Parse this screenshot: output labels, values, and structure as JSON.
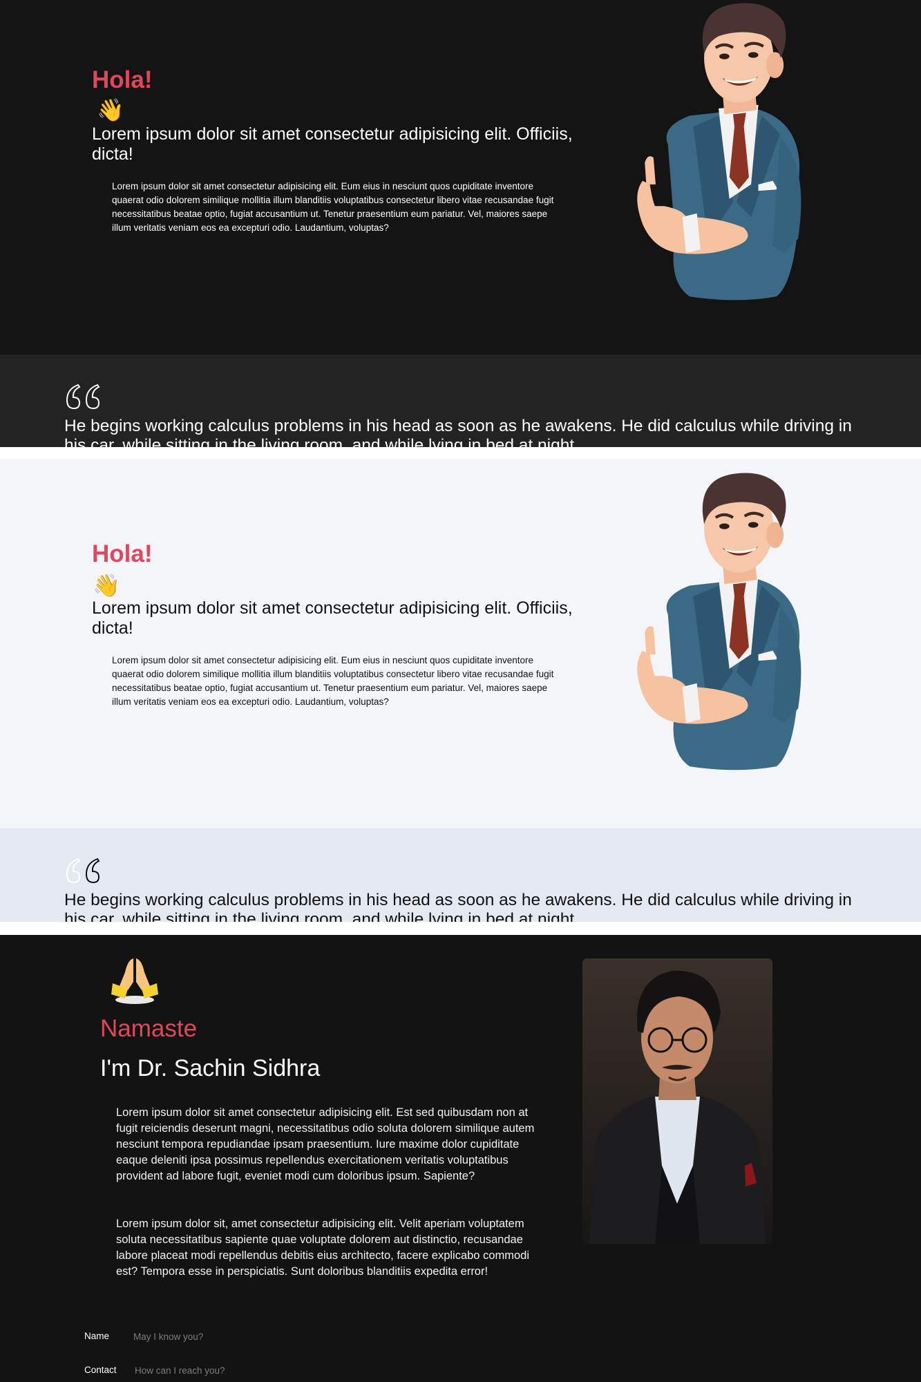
{
  "hero_dark": {
    "greeting": "Hola!",
    "wave": "👋",
    "headline": "Lorem ipsum dolor sit amet consectetur adipisicing elit. Officiis, dicta!",
    "paragraph": "Lorem ipsum dolor sit amet consectetur adipisicing elit. Eum eius in nesciunt quos cupiditate inventore quaerat odio dolorem similique mollitia illum blanditiis voluptatibus consectetur libero vitae recusandae fugit necessitatibus beatae optio, fugiat accusantium ut. Tenetur praesentium eum pariatur. Vel, maiores saepe illum veritatis veniam eos ea excepturi odio. Laudantium, voluptas?"
  },
  "quote_dark": {
    "text": "He begins working calculus problems in his head as soon as he awakens. He did calculus while driving in his car, while sitting in the living room, and while lying in bed at night."
  },
  "hero_light": {
    "greeting": "Hola!",
    "wave": "👋",
    "headline": "Lorem ipsum dolor sit amet consectetur adipisicing elit. Officiis, dicta!",
    "paragraph": "Lorem ipsum dolor sit amet consectetur adipisicing elit. Eum eius in nesciunt quos cupiditate inventore quaerat odio dolorem similique mollitia illum blanditiis voluptatibus consectetur libero vitae recusandae fugit necessitatibus beatae optio, fugiat accusantium ut. Tenetur praesentium eum pariatur. Vel, maiores saepe illum veritatis veniam eos ea excepturi odio. Laudantium, voluptas?"
  },
  "quote_light": {
    "text": "He begins working calculus problems in his head as soon as he awakens. He did calculus while driving in his car, while sitting in the living room, and while lying in bed at night."
  },
  "about": {
    "greeting": "Namaste",
    "intro": "I'm Dr. Sachin Sidhra",
    "paragraph1": "Lorem ipsum dolor sit amet consectetur adipisicing elit. Est sed quibusdam non at fugit reiciendis deserunt magni, necessitatibus odio soluta dolorem similique autem nesciunt tempora repudiandae ipsam praesentium. Iure maxime dolor cupiditate eaque deleniti ipsa possimus repellendus exercitationem veritatis voluptatibus provident ad labore fugit, eveniet modi cum doloribus ipsum. Sapiente?",
    "paragraph2": "Lorem ipsum dolor sit, amet consectetur adipisicing elit. Velit aperiam voluptatem soluta necessitatibus sapiente quae voluptate dolorem aut distinctio, recusandae labore placeat modi repellendus debitis eius architecto, facere explicabo commodi est? Tempora esse in perspiciatis. Sunt doloribus blanditiis expedita error!"
  },
  "form": {
    "name_label": "Name",
    "name_placeholder": "May I know you?",
    "contact_label": "Contact",
    "contact_placeholder": "How can I reach you?"
  },
  "colors": {
    "accent": "#e0475d",
    "dark_bg": "#141414",
    "quote_dark_bg": "#232323",
    "light_bg": "#f3f5f9",
    "quote_light_bg": "#e3e8f1"
  }
}
